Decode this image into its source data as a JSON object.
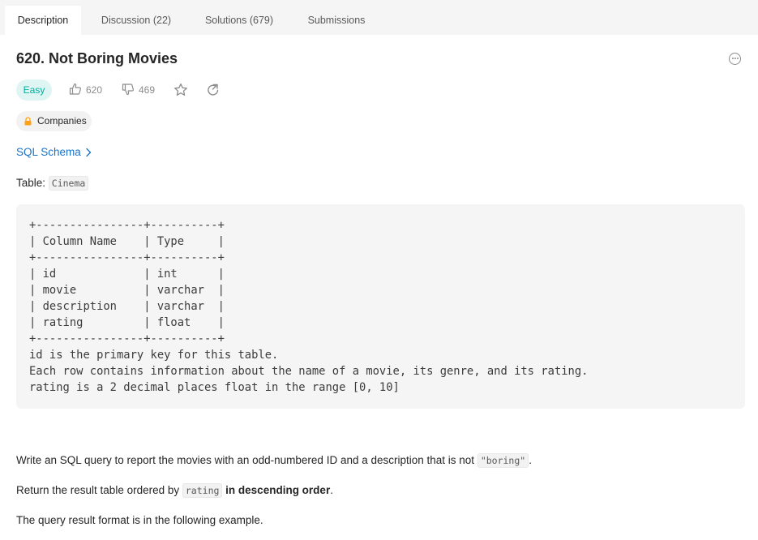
{
  "tabs": [
    {
      "label": "Description"
    },
    {
      "label": "Discussion (22)"
    },
    {
      "label": "Solutions (679)"
    },
    {
      "label": "Submissions"
    }
  ],
  "problem": {
    "title": "620. Not Boring Movies",
    "difficulty": "Easy",
    "likes": "620",
    "dislikes": "469",
    "companies_label": "Companies",
    "schema_link": "SQL Schema"
  },
  "content": {
    "table_label": "Table: ",
    "table_name": "Cinema",
    "schema_block": "+----------------+----------+\n| Column Name    | Type     |\n+----------------+----------+\n| id             | int      |\n| movie          | varchar  |\n| description    | varchar  |\n| rating         | float    |\n+----------------+----------+\nid is the primary key for this table.\nEach row contains information about the name of a movie, its genre, and its rating.\nrating is a 2 decimal places float in the range [0, 10]",
    "p1_before": "Write an SQL query to report the movies with an odd-numbered ID and a description that is not ",
    "p1_code": "\"boring\"",
    "p1_after": ".",
    "p2_before": "Return the result table ordered by ",
    "p2_code": "rating",
    "p2_bold": " in descending order",
    "p2_after": ".",
    "p3": "The query result format is in the following example."
  },
  "colors": {
    "easy": "#00af9b",
    "easy_bg": "#dff5f3",
    "link": "#1a73c9",
    "lock": "#ffa116"
  },
  "icons": [
    "thumbs-up-icon",
    "thumbs-down-icon",
    "star-icon",
    "share-icon",
    "lock-icon",
    "chevron-right-icon",
    "more-icon"
  ]
}
